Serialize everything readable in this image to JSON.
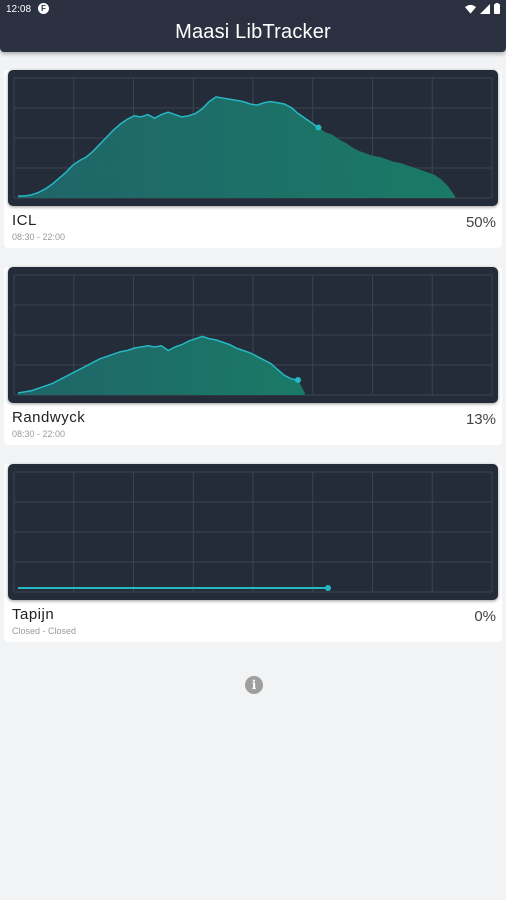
{
  "status_bar": {
    "time": "12:08",
    "notification_icon": "F"
  },
  "app": {
    "title": "Maasi LibTracker"
  },
  "colors": {
    "chart_bg": "#252c39",
    "line": "#25b8c4",
    "fill_top": "#1f6b6e",
    "fill_mid": "#1a7a66",
    "grid": "#3a4350"
  },
  "libraries": [
    {
      "name": "ICL",
      "hours": "08:30 - 22:00",
      "occupancy": "50%",
      "chart_data": {
        "type": "area",
        "y": [
          0,
          0,
          1,
          3,
          6,
          10,
          15,
          20,
          26,
          30,
          33,
          38,
          44,
          50,
          56,
          61,
          65,
          68,
          67,
          69,
          66,
          69,
          71,
          69,
          67,
          68,
          70,
          74,
          80,
          84,
          83,
          82,
          81,
          80,
          78,
          77,
          79,
          80,
          79,
          78,
          75,
          70,
          66,
          62,
          58,
          54,
          52,
          48,
          45,
          41,
          38,
          36,
          34,
          33,
          31,
          29,
          28,
          26,
          24,
          22,
          20,
          18,
          14,
          8,
          0
        ],
        "current_index": 44
      }
    },
    {
      "name": "Randwyck",
      "hours": "08:30 - 22:00",
      "occupancy": "13%",
      "chart_data": {
        "type": "area",
        "y": [
          0,
          1,
          2,
          4,
          6,
          8,
          11,
          14,
          17,
          20,
          23,
          26,
          29,
          31,
          33,
          35,
          36,
          38,
          39,
          40,
          39,
          40,
          36,
          39,
          41,
          44,
          46,
          48,
          46,
          45,
          43,
          41,
          38,
          36,
          34,
          31,
          28,
          25,
          20,
          15,
          12,
          11,
          0
        ],
        "current_index": 41
      }
    },
    {
      "name": "Tapijn",
      "hours": "Closed - Closed",
      "occupancy": "0%",
      "chart_data": {
        "type": "line",
        "y": [
          0,
          0
        ],
        "current_index": 1
      }
    }
  ]
}
